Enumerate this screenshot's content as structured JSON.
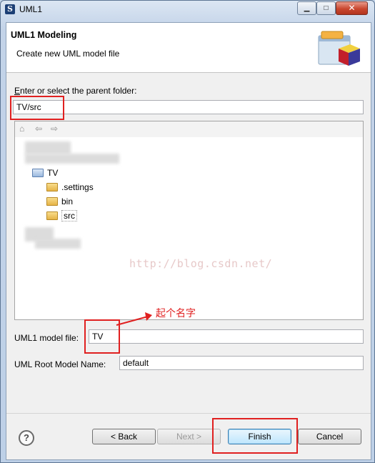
{
  "window": {
    "title": "UML1",
    "minimize_glyph": "▁",
    "maximize_glyph": "□",
    "close_glyph": "✕"
  },
  "header": {
    "title": "UML1 Modeling",
    "description": "Create new UML model file"
  },
  "folder": {
    "label": "Enter or select the parent folder:",
    "label_mnemonic": "E",
    "label_rest": "nter or select the parent folder:",
    "value": "TV/src"
  },
  "tree": {
    "toolbar_icons": [
      "home-icon",
      "back-icon",
      "forward-icon"
    ],
    "nodes": [
      {
        "label": "TV",
        "level": 0,
        "type": "project"
      },
      {
        "label": ".settings",
        "level": 1,
        "type": "folder"
      },
      {
        "label": "bin",
        "level": 1,
        "type": "folder"
      },
      {
        "label": "src",
        "level": 1,
        "type": "folder",
        "selected": true
      }
    ]
  },
  "model_file": {
    "label": "UML1 model file:",
    "value": "TV"
  },
  "root_model": {
    "label": "UML Root Model Name:",
    "value": "default"
  },
  "buttons": {
    "help": "?",
    "back": "< Back",
    "next": "Next >",
    "finish": "Finish",
    "cancel": "Cancel"
  },
  "annotations": {
    "watermark": "http://blog.csdn.net/",
    "note": "起个名字",
    "color": "#e02020"
  }
}
